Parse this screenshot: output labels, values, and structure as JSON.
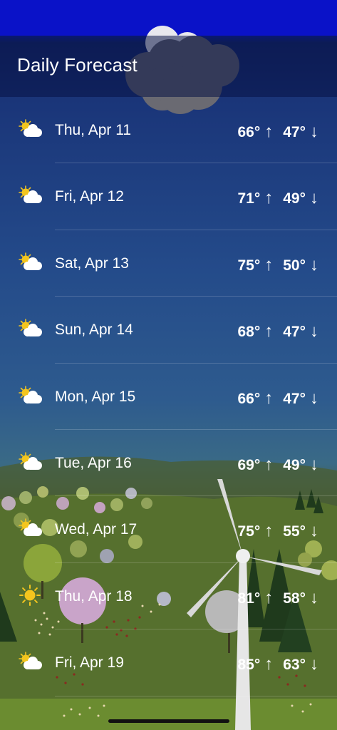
{
  "header": {
    "title": "Daily Forecast"
  },
  "forecast": [
    {
      "date": "Thu, Apr 11",
      "high": "66°",
      "low": "47°",
      "icon": "partly-sunny-icon"
    },
    {
      "date": "Fri, Apr 12",
      "high": "71°",
      "low": "49°",
      "icon": "partly-sunny-icon"
    },
    {
      "date": "Sat, Apr 13",
      "high": "75°",
      "low": "50°",
      "icon": "partly-sunny-icon"
    },
    {
      "date": "Sun, Apr 14",
      "high": "68°",
      "low": "47°",
      "icon": "partly-sunny-icon"
    },
    {
      "date": "Mon, Apr 15",
      "high": "66°",
      "low": "47°",
      "icon": "partly-sunny-icon"
    },
    {
      "date": "Tue, Apr 16",
      "high": "69°",
      "low": "49°",
      "icon": "partly-sunny-icon"
    },
    {
      "date": "Wed, Apr 17",
      "high": "75°",
      "low": "55°",
      "icon": "partly-sunny-icon"
    },
    {
      "date": "Thu, Apr 18",
      "high": "81°",
      "low": "58°",
      "icon": "sunny-icon"
    },
    {
      "date": "Fri, Apr 19",
      "high": "85°",
      "low": "63°",
      "icon": "partly-sunny-icon"
    }
  ],
  "arrows": {
    "up": "↑",
    "down": "↓"
  }
}
